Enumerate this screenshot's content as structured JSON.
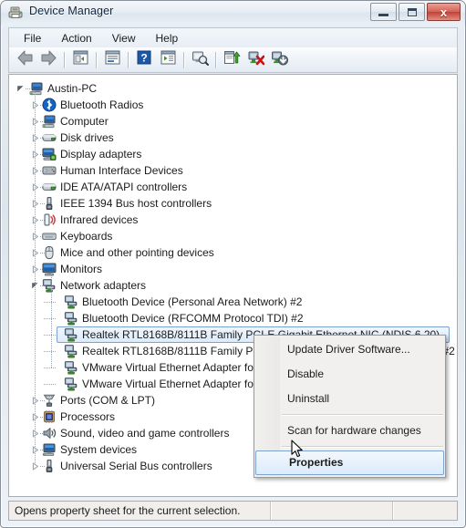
{
  "window": {
    "title": "Device Manager",
    "icon": "device-manager-icon",
    "buttons": {
      "minimize": "minimize-icon",
      "maximize": "maximize-icon",
      "close": "✕",
      "close_glyph": "x"
    }
  },
  "menubar": {
    "items": [
      {
        "label": "File"
      },
      {
        "label": "Action"
      },
      {
        "label": "View"
      },
      {
        "label": "Help"
      }
    ]
  },
  "toolbar": {
    "buttons": [
      {
        "name": "back-icon",
        "tooltip": "Back"
      },
      {
        "name": "forward-icon",
        "tooltip": "Forward"
      },
      {
        "name": "show-hide-console-tree-icon",
        "tooltip": "Show/Hide Console Tree"
      },
      {
        "name": "properties-icon",
        "tooltip": "Properties"
      },
      {
        "name": "help-icon",
        "tooltip": "Help"
      },
      {
        "name": "show-details-icon",
        "tooltip": "Show Details"
      },
      {
        "name": "scan-for-hardware-changes-icon",
        "tooltip": "Scan for hardware changes"
      },
      {
        "name": "update-driver-software-icon",
        "tooltip": "Update Driver Software"
      },
      {
        "name": "disable-device-icon",
        "tooltip": "Disable"
      },
      {
        "name": "uninstall-device-icon",
        "tooltip": "Uninstall"
      }
    ]
  },
  "tree": {
    "root": {
      "label": "Austin-PC",
      "icon": "computer-icon",
      "expanded": true
    },
    "items": [
      {
        "label": "Bluetooth Radios",
        "icon": "bluetooth-icon",
        "expanded": false,
        "depth": 1
      },
      {
        "label": "Computer",
        "icon": "computer-icon",
        "expanded": false,
        "depth": 1
      },
      {
        "label": "Disk drives",
        "icon": "disk-drive-icon",
        "expanded": false,
        "depth": 1
      },
      {
        "label": "Display adapters",
        "icon": "display-adapter-icon",
        "expanded": false,
        "depth": 1
      },
      {
        "label": "Human Interface Devices",
        "icon": "hid-icon",
        "expanded": false,
        "depth": 1
      },
      {
        "label": "IDE ATA/ATAPI controllers",
        "icon": "ide-controller-icon",
        "expanded": false,
        "depth": 1
      },
      {
        "label": "IEEE 1394 Bus host controllers",
        "icon": "ieee1394-icon",
        "expanded": false,
        "depth": 1
      },
      {
        "label": "Infrared devices",
        "icon": "infrared-icon",
        "expanded": false,
        "depth": 1
      },
      {
        "label": "Keyboards",
        "icon": "keyboard-icon",
        "expanded": false,
        "depth": 1
      },
      {
        "label": "Mice and other pointing devices",
        "icon": "mouse-icon",
        "expanded": false,
        "depth": 1
      },
      {
        "label": "Monitors",
        "icon": "monitor-icon",
        "expanded": false,
        "depth": 1
      },
      {
        "label": "Network adapters",
        "icon": "network-adapter-icon",
        "expanded": true,
        "depth": 1
      },
      {
        "label": "Bluetooth Device (Personal Area Network) #2",
        "icon": "network-adapter-icon",
        "depth": 2,
        "leaf": true
      },
      {
        "label": "Bluetooth Device (RFCOMM Protocol TDI) #2",
        "icon": "network-adapter-icon",
        "depth": 2,
        "leaf": true
      },
      {
        "label": "Realtek RTL8168B/8111B Family PCI-E Gigabit Ethernet NIC (NDIS 6.20)",
        "icon": "network-adapter-icon",
        "depth": 2,
        "leaf": true,
        "selected": true
      },
      {
        "label": "Realtek RTL8168B/8111B Family PCI-E Gigabit Ethernet NIC (NDIS 6.20) #2",
        "icon": "network-adapter-icon",
        "depth": 2,
        "leaf": true
      },
      {
        "label": "VMware Virtual Ethernet Adapter for VMnet1",
        "icon": "network-adapter-icon",
        "depth": 2,
        "leaf": true
      },
      {
        "label": "VMware Virtual Ethernet Adapter for VMnet8",
        "icon": "network-adapter-icon",
        "depth": 2,
        "leaf": true
      },
      {
        "label": "Ports (COM & LPT)",
        "icon": "port-icon",
        "expanded": false,
        "depth": 1
      },
      {
        "label": "Processors",
        "icon": "processor-icon",
        "expanded": false,
        "depth": 1
      },
      {
        "label": "Sound, video and game controllers",
        "icon": "sound-icon",
        "expanded": false,
        "depth": 1
      },
      {
        "label": "System devices",
        "icon": "system-device-icon",
        "expanded": false,
        "depth": 1
      },
      {
        "label": "Universal Serial Bus controllers",
        "icon": "usb-icon",
        "expanded": false,
        "depth": 1
      }
    ]
  },
  "context_menu": {
    "items": [
      {
        "label": "Update Driver Software...",
        "type": "item"
      },
      {
        "label": "Disable",
        "type": "item"
      },
      {
        "label": "Uninstall",
        "type": "item"
      },
      {
        "type": "separator"
      },
      {
        "label": "Scan for hardware changes",
        "type": "item"
      },
      {
        "type": "separator"
      },
      {
        "label": "Properties",
        "type": "item",
        "bold": true,
        "hover": true
      }
    ]
  },
  "statusbar": {
    "text": "Opens property sheet for the current selection."
  },
  "colors": {
    "selection_border": "#7da2ce",
    "selection_fill": "#dcebfb",
    "close_button": "#bf4236",
    "text": "#1b1b1b"
  }
}
